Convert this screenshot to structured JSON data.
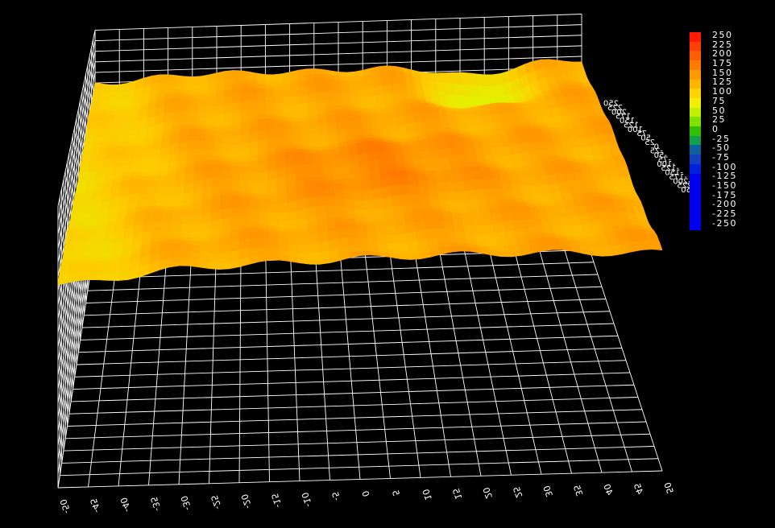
{
  "chart_data": {
    "type": "surface3d",
    "x_ticks": [
      "-50",
      "-45",
      "-40",
      "-35",
      "-30",
      "-25",
      "-20",
      "-15",
      "-10",
      "-5",
      "0",
      "5",
      "10",
      "15",
      "20",
      "25",
      "30",
      "35",
      "40",
      "45",
      "50"
    ],
    "y_ticks": [
      "-250",
      "-225",
      "-200",
      "-175",
      "-150",
      "-125",
      "-100",
      "-75",
      "-50",
      "-25",
      "0",
      "25",
      "50",
      "75",
      "100",
      "125",
      "150",
      "175",
      "200",
      "225",
      "250"
    ],
    "z_range": [
      -250,
      250
    ],
    "grid": true,
    "colorbar": {
      "placement": "top-right",
      "labels": [
        "250",
        "225",
        "200",
        "175",
        "150",
        "125",
        "100",
        "75",
        "50",
        "25",
        "0",
        "-25",
        "-50",
        "-75",
        "-100",
        "-125",
        "-150",
        "-175",
        "-200",
        "-225",
        "-250"
      ],
      "colors": [
        "#ff1a00",
        "#ff4000",
        "#ff5e00",
        "#ff7a00",
        "#ff9a00",
        "#ffb400",
        "#ffd200",
        "#f2f000",
        "#c0f000",
        "#80e000",
        "#30c000",
        "#10a050",
        "#1060a0",
        "#1040c0",
        "#0020e0",
        "#0000f0",
        "#0000f0",
        "#0000f0",
        "#0000f0",
        "#0000f0",
        "#0000f0"
      ]
    },
    "surface": {
      "value_range": [
        30,
        165
      ],
      "z_at_x_-50": [
        110,
        95
      ],
      "z_at_center": 140,
      "z_low_patch": 40
    }
  }
}
